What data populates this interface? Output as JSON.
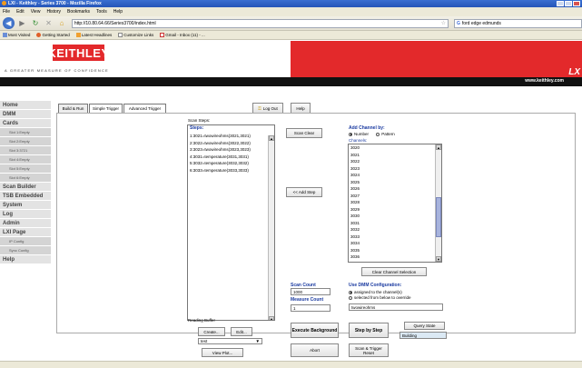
{
  "browser": {
    "title": "LXI - Keithley - Series 3700 - Mozilla Firefox",
    "menu": [
      "File",
      "Edit",
      "View",
      "History",
      "Bookmarks",
      "Tools",
      "Help"
    ],
    "url": "http://10.80.64.66/Series3700/index.html",
    "search_value": "ford edge edmunds",
    "bookmarks": [
      "Most Visited",
      "Getting Started",
      "Latest Headlines",
      "Customize Links",
      "Gmail - Inbox (11) - ..."
    ]
  },
  "brand": {
    "logo": "KEITHLEY",
    "tagline": "A GREATER MEASURE OF CONFIDENCE",
    "lx_mark": "LX",
    "website": "www.keithley.com",
    "red": "#e3292b"
  },
  "sidebar": {
    "home": "Home",
    "dmm": "DMM",
    "cards": "Cards",
    "slots": [
      "Slot 1:Empty",
      "Slot 2:Empty",
      "Slot 3:3721",
      "Slot 4:Empty",
      "Slot 5:Empty",
      "Slot 6:Empty"
    ],
    "scan_builder": "Scan Builder",
    "tsb_embedded": "TSB Embedded",
    "system": "System",
    "log": "Log",
    "admin": "Admin",
    "lxi_page": "LXI Page",
    "ip_config": "IP Config",
    "sync_config": "Sync Config",
    "help": "Help"
  },
  "tabs": {
    "build_run": "Build & Run",
    "simple_trigger": "Simple Trigger",
    "advanced_trigger": "Advanced Trigger",
    "log_out": "Log Out",
    "help": "Help"
  },
  "scan": {
    "scan_steps_label": "Scan Steps:",
    "steps_label": "Steps:",
    "steps": [
      "1:3021=twowireohms(3021,3021)",
      "2:3022=twowireohms(3022,3022)",
      "3:3023=twowireohms(3023,3023)",
      "4:3031=temperature(3031,3031)",
      "5:3032=temperature(3032,3032)",
      "6:3033=temperature(3033,3033)"
    ],
    "scan_clear": "Scan Clear",
    "add_step": "<< Add Step",
    "add_channel_by": "Add Channel by:",
    "by_number": "Number",
    "by_pattern": "Pattern",
    "channels_label": "Channels:",
    "channels": [
      "3020",
      "3021",
      "3022",
      "3023",
      "3024",
      "3025",
      "3026",
      "3027",
      "3028",
      "3029",
      "3030",
      "3031",
      "3032",
      "3033",
      "3034",
      "3035",
      "3036"
    ],
    "clear_channel_selection": "Clear Channel Selection",
    "scan_count_label": "Scan Count",
    "scan_count_value": "1000",
    "measure_count_label": "Measure Count",
    "measure_count_value": "1",
    "use_dmm_config": "Use DMM Configuration:",
    "assigned": "assigned to the channel(s)",
    "selected_override": "selected from below to override",
    "dmm_config_value": "twowireohms"
  },
  "reading_buffer": {
    "label": "Reading Buffer",
    "create": "Create...",
    "edit": "Edit...",
    "selected": "test",
    "view_plot": "View Plot..."
  },
  "actions": {
    "execute_background": "Execute Background",
    "step_by_step": "Step by Step",
    "query_state": "Query State",
    "state_value": "Building",
    "abort": "Abort",
    "scan_trigger_reset": "Scan & Trigger Reset"
  }
}
